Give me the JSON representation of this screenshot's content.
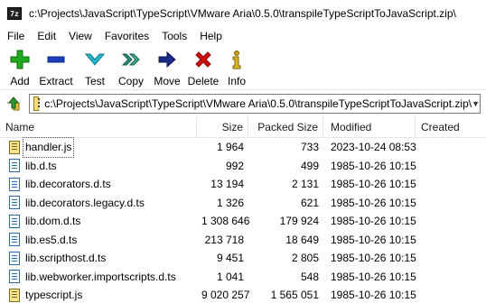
{
  "window": {
    "app_icon_text": "7z",
    "title": "c:\\Projects\\JavaScript\\TypeScript\\VMware Aria\\0.5.0\\transpileTypeScriptToJavaScript.zip\\"
  },
  "menu": [
    {
      "label": "File"
    },
    {
      "label": "Edit"
    },
    {
      "label": "View"
    },
    {
      "label": "Favorites"
    },
    {
      "label": "Tools"
    },
    {
      "label": "Help"
    }
  ],
  "toolbar": {
    "add": {
      "label": "Add",
      "icon": "plus-icon",
      "color": "#1faa1f"
    },
    "extract": {
      "label": "Extract",
      "icon": "minus-icon",
      "color": "#1a3fbf"
    },
    "test": {
      "label": "Test",
      "icon": "chevron-down-icon",
      "color": "#1aa6b8"
    },
    "copy": {
      "label": "Copy",
      "icon": "copy-arrow-icon",
      "color": "#2a8f7a"
    },
    "move": {
      "label": "Move",
      "icon": "arrow-right-icon",
      "color": "#1b2a8a"
    },
    "delete": {
      "label": "Delete",
      "icon": "x-icon",
      "color": "#d01010"
    },
    "info": {
      "label": "Info",
      "icon": "info-icon",
      "color": "#c8a010"
    }
  },
  "address": {
    "path": "c:\\Projects\\JavaScript\\TypeScript\\VMware Aria\\0.5.0\\transpileTypeScriptToJavaScript.zip\\"
  },
  "columns": {
    "name": "Name",
    "size": "Size",
    "packed": "Packed Size",
    "modified": "Modified",
    "created": "Created"
  },
  "files": [
    {
      "name": "handler.js",
      "type": "js",
      "size": "1 964",
      "packed": "733",
      "modified": "2023-10-24 08:53",
      "created": ""
    },
    {
      "name": "lib.d.ts",
      "type": "ts",
      "size": "992",
      "packed": "499",
      "modified": "1985-10-26 10:15",
      "created": ""
    },
    {
      "name": "lib.decorators.d.ts",
      "type": "ts",
      "size": "13 194",
      "packed": "2 131",
      "modified": "1985-10-26 10:15",
      "created": ""
    },
    {
      "name": "lib.decorators.legacy.d.ts",
      "type": "ts",
      "size": "1 326",
      "packed": "621",
      "modified": "1985-10-26 10:15",
      "created": ""
    },
    {
      "name": "lib.dom.d.ts",
      "type": "ts",
      "size": "1 308 646",
      "packed": "179 924",
      "modified": "1985-10-26 10:15",
      "created": ""
    },
    {
      "name": "lib.es5.d.ts",
      "type": "ts",
      "size": "213 718",
      "packed": "18 649",
      "modified": "1985-10-26 10:15",
      "created": ""
    },
    {
      "name": "lib.scripthost.d.ts",
      "type": "ts",
      "size": "9 451",
      "packed": "2 805",
      "modified": "1985-10-26 10:15",
      "created": ""
    },
    {
      "name": "lib.webworker.importscripts.d.ts",
      "type": "ts",
      "size": "1 041",
      "packed": "548",
      "modified": "1985-10-26 10:15",
      "created": ""
    },
    {
      "name": "typescript.js",
      "type": "js",
      "size": "9 020 257",
      "packed": "1 565 051",
      "modified": "1985-10-26 10:15",
      "created": ""
    }
  ]
}
